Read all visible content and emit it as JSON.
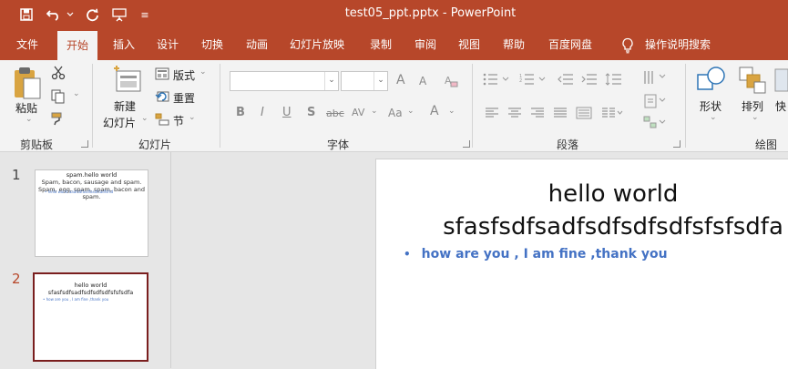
{
  "window": {
    "title": "test05_ppt.pptx  -  PowerPoint"
  },
  "qat": {
    "overflow_label": "≡"
  },
  "menu": {
    "tabs": [
      "文件",
      "开始",
      "插入",
      "设计",
      "切换",
      "动画",
      "幻灯片放映",
      "录制",
      "审阅",
      "视图",
      "帮助",
      "百度网盘"
    ],
    "active": "开始",
    "tell_me": "操作说明搜索"
  },
  "ribbon": {
    "clipboard": {
      "paste": "粘贴",
      "group": "剪贴板"
    },
    "slides": {
      "new_slide_1": "新建",
      "new_slide_2": "幻灯片",
      "layout": "版式",
      "reset": "重置",
      "section": "节",
      "group": "幻灯片"
    },
    "font": {
      "group": "字体",
      "grow": "A",
      "shrink": "A",
      "bold": "B",
      "italic": "I",
      "underline": "U",
      "shadow": "S",
      "strike": "abc",
      "spacing": "AV",
      "case": "Aa",
      "color": "A",
      "clear": "A"
    },
    "paragraph": {
      "group": "段落"
    },
    "drawing": {
      "shapes": "形状",
      "arrange": "排列",
      "quick": "快",
      "group": "绘图"
    }
  },
  "thumbnails": [
    {
      "number": "1",
      "title": "spam.hello world",
      "body": [
        "Spam, bacon, sausage and spam.",
        "Spam, egg, spam, spam, bacon and",
        "spam."
      ],
      "bullet": "• hello world aaafsdfasdfasdfsadfsfsd"
    },
    {
      "number": "2",
      "title": "hello world",
      "subtitle": "sfasfsdfsadfsdfsdfsdfsfsfsdfa",
      "bullet": "• how are you , I am fine ,thank you"
    }
  ],
  "slide": {
    "title_line1": "hello world",
    "title_line2": "sfasfsdfsadfsdfsdfsdfsfsfsdfa",
    "bullet": "how are you , I am fine ,thank you"
  },
  "colors": {
    "accent": "#b7472a",
    "selected_thumb": "#7a1e1e",
    "bullet_text": "#4472c4"
  }
}
